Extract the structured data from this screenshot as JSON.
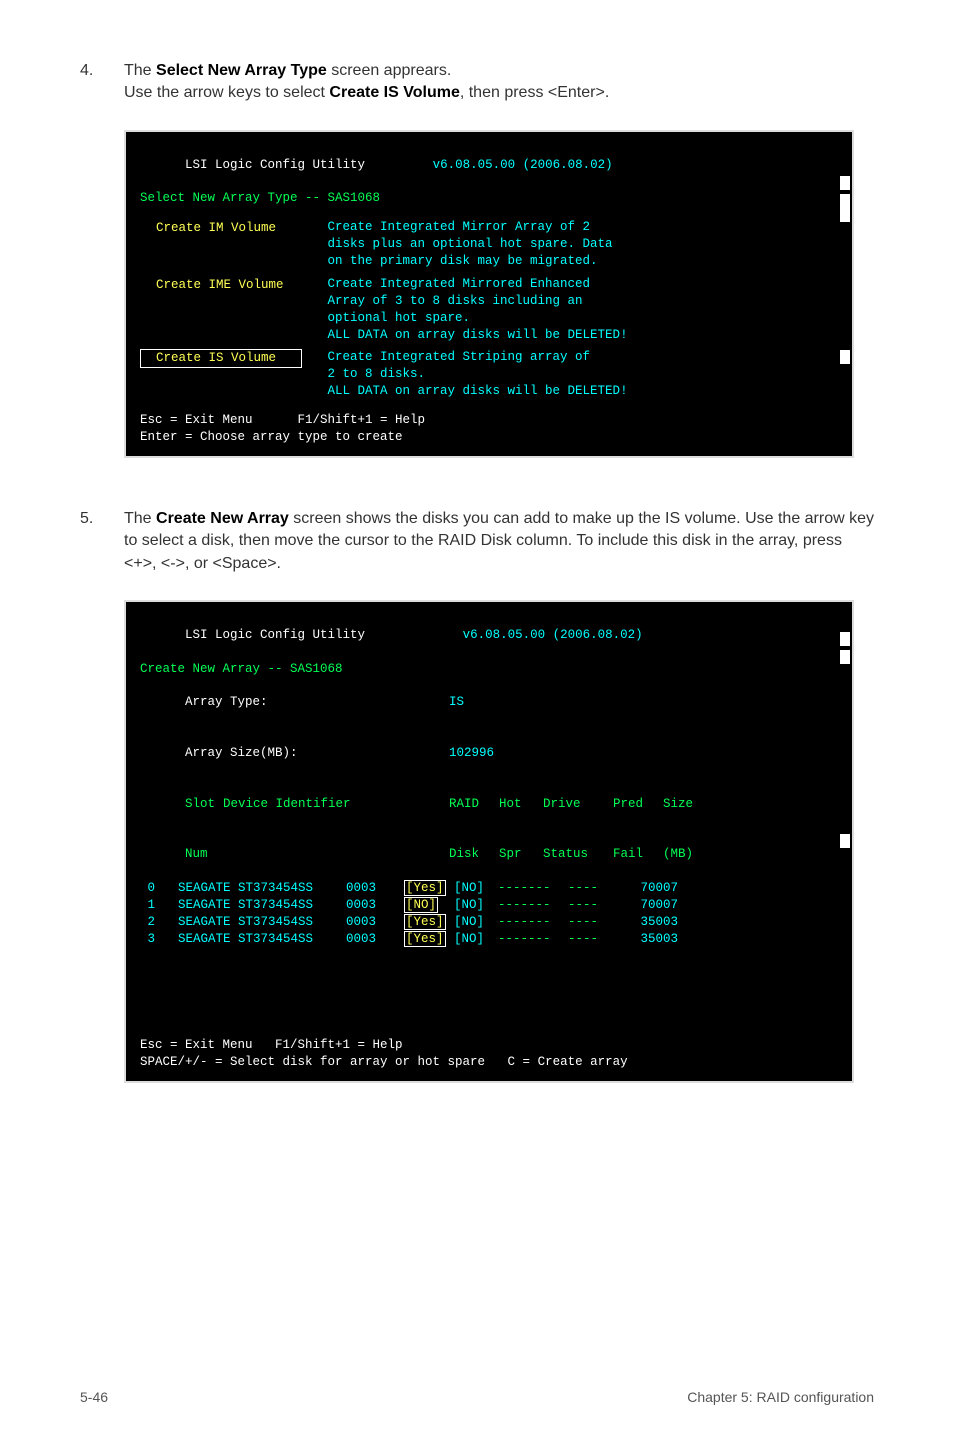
{
  "step4": {
    "num": "4.",
    "line1_a": "The ",
    "line1_b": "Select New Array Type",
    "line1_c": " screen apprears.",
    "line2_a": "Use the arrow keys to select ",
    "line2_b": "Create IS Volume",
    "line2_c": ", then press <Enter>."
  },
  "term1": {
    "title_left": "LSI Logic Config Utility",
    "title_right": "v6.08.05.00 (2006.08.02)",
    "subtitle": "Select New Array Type -- SAS1068",
    "items": [
      {
        "label": "Create IM Volume",
        "selected": false,
        "desc": "Create Integrated Mirror Array of 2\ndisks plus an optional hot spare. Data\non the primary disk may be migrated."
      },
      {
        "label": "Create IME Volume",
        "selected": false,
        "desc": "Create Integrated Mirrored Enhanced\nArray of 3 to 8 disks including an\noptional hot spare.\nALL DATA on array disks will be DELETED!"
      },
      {
        "label": "Create IS Volume",
        "selected": true,
        "desc": "Create Integrated Striping array of\n2 to 8 disks.\nALL DATA on array disks will be DELETED!"
      }
    ],
    "help1": "Esc = Exit Menu      F1/Shift+1 = Help",
    "help2": "Enter = Choose array type to create"
  },
  "step5": {
    "num": "5.",
    "text_a": "The ",
    "text_b": "Create New Array",
    "text_c": " screen shows the disks you can add to make up the IS volume. Use the arrow key to select a disk, then move the cursor to the RAID Disk column. To include this disk in the array, press <+>, <->, or <Space>."
  },
  "term2": {
    "title_left": "LSI Logic Config Utility",
    "title_right": "v6.08.05.00 (2006.08.02)",
    "subtitle": "Create New Array -- SAS1068",
    "array_type_label": "Array Type:",
    "array_type_value": "IS",
    "array_size_label": "Array Size(MB):",
    "array_size_value": "102996",
    "headers": {
      "slot": "Slot",
      "num": "Num",
      "device": "Device Identifier",
      "raid": "RAID",
      "disk": "Disk",
      "hot": "Hot",
      "spr": "Spr",
      "drive": "Drive",
      "status": "Status",
      "pred": "Pred",
      "fail": "Fail",
      "size": "Size",
      "mb": "(MB)"
    },
    "rows": [
      {
        "slot": "0",
        "dev": "SEAGATE ST373454SS",
        "rev": "0003",
        "raid": "[Yes]",
        "raid_sel": true,
        "hot": "[NO]",
        "drive": "-------",
        "pred": "----",
        "size": "70007"
      },
      {
        "slot": "1",
        "dev": "SEAGATE ST373454SS",
        "rev": "0003",
        "raid": "[NO]",
        "raid_sel": true,
        "hot": "[NO]",
        "drive": "-------",
        "pred": "----",
        "size": "70007"
      },
      {
        "slot": "2",
        "dev": "SEAGATE ST373454SS",
        "rev": "0003",
        "raid": "[Yes]",
        "raid_sel": true,
        "hot": "[NO]",
        "drive": "-------",
        "pred": "----",
        "size": "35003"
      },
      {
        "slot": "3",
        "dev": "SEAGATE ST373454SS",
        "rev": "0003",
        "raid": "[Yes]",
        "raid_sel": true,
        "hot": "[NO]",
        "drive": "-------",
        "pred": "----",
        "size": "35003"
      }
    ],
    "help1": "Esc = Exit Menu   F1/Shift+1 = Help",
    "help2": "SPACE/+/- = Select disk for array or hot spare   C = Create array"
  },
  "footer": {
    "left": "5-46",
    "right": "Chapter 5: RAID configuration"
  }
}
